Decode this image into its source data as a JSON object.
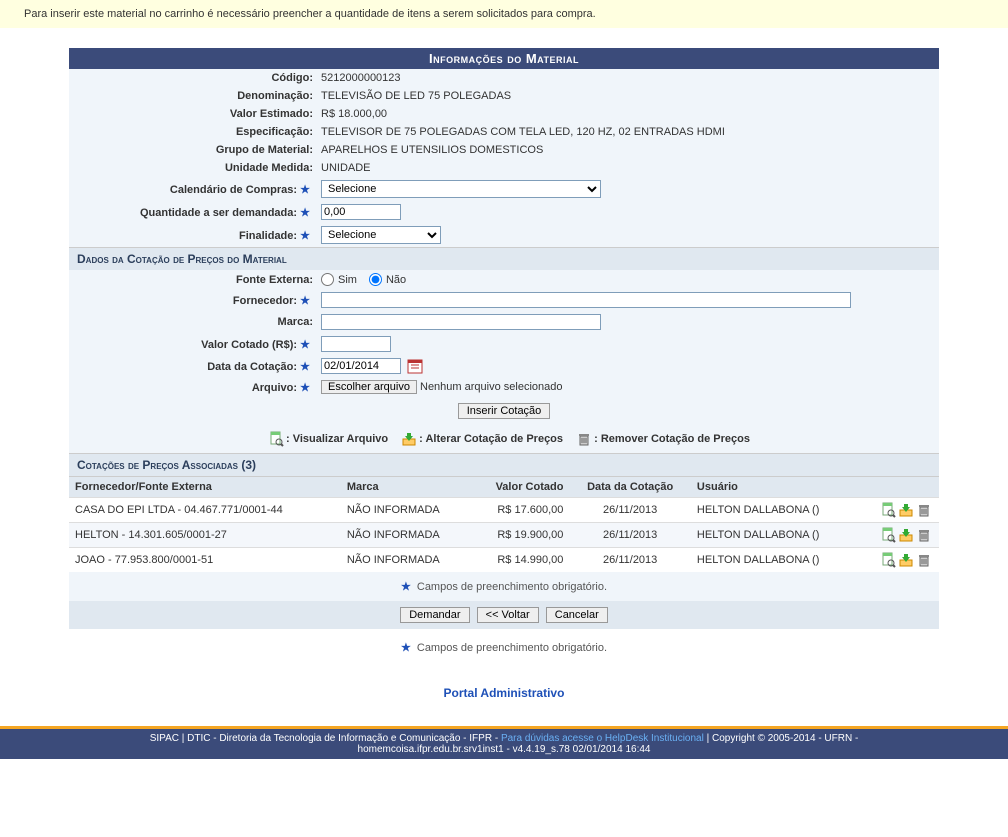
{
  "banner": "Para inserir este material no carrinho é necessário preencher a quantidade de itens a serem solicitados para compra.",
  "panel_title": "Informações do Material",
  "material": {
    "codigo_label": "Código:",
    "codigo": "5212000000123",
    "denominacao_label": "Denominação:",
    "denominacao": "TELEVISÃO DE LED 75 POLEGADAS",
    "valor_estimado_label": "Valor Estimado:",
    "valor_estimado": "R$ 18.000,00",
    "especificacao_label": "Especificação:",
    "especificacao": "TELEVISOR DE 75 POLEGADAS COM TELA LED, 120 HZ, 02 ENTRADAS HDMI",
    "grupo_label": "Grupo de Material:",
    "grupo": "APARELHOS E UTENSILIOS DOMESTICOS",
    "unidade_label": "Unidade Medida:",
    "unidade": "UNIDADE"
  },
  "form": {
    "calendario_label": "Calendário de Compras:",
    "calendario_selected": "Selecione",
    "quantidade_label": "Quantidade a ser demandada:",
    "quantidade_value": "0,00",
    "finalidade_label": "Finalidade:",
    "finalidade_selected": "Selecione"
  },
  "cotacao_section": "Dados da Cotação de Preços do Material",
  "cotacao": {
    "fonte_label": "Fonte Externa:",
    "sim": "Sim",
    "nao": "Não",
    "fornecedor_label": "Fornecedor:",
    "marca_label": "Marca:",
    "valor_label": "Valor Cotado (R$):",
    "data_label": "Data da Cotação:",
    "data_value": "02/01/2014",
    "arquivo_label": "Arquivo:",
    "escolher_btn": "Escolher arquivo",
    "nenhum_arquivo": "Nenhum arquivo selecionado",
    "inserir_btn": "Inserir Cotação"
  },
  "legend": {
    "visualizar": ": Visualizar Arquivo",
    "alterar": ": Alterar Cotação de Preços",
    "remover": ": Remover Cotação de Preços"
  },
  "table_title": "Cotações de Preços Associadas (3)",
  "table": {
    "headers": {
      "fornecedor": "Fornecedor/Fonte Externa",
      "marca": "Marca",
      "valor": "Valor Cotado",
      "data": "Data da Cotação",
      "usuario": "Usuário"
    },
    "rows": [
      {
        "fornecedor": "CASA DO EPI LTDA - 04.467.771/0001-44",
        "marca": "NÃO INFORMADA",
        "valor": "R$ 17.600,00",
        "data": "26/11/2013",
        "usuario": "HELTON DALLABONA ()"
      },
      {
        "fornecedor": "HELTON - 14.301.605/0001-27",
        "marca": "NÃO INFORMADA",
        "valor": "R$ 19.900,00",
        "data": "26/11/2013",
        "usuario": "HELTON DALLABONA ()"
      },
      {
        "fornecedor": "JOAO - 77.953.800/0001-51",
        "marca": "NÃO INFORMADA",
        "valor": "R$ 14.990,00",
        "data": "26/11/2013",
        "usuario": "HELTON DALLABONA ()"
      }
    ]
  },
  "campos_obrig": "Campos de preenchimento obrigatório.",
  "buttons": {
    "demandar": "Demandar",
    "voltar": "<< Voltar",
    "cancelar": "Cancelar"
  },
  "portal_link": "Portal Administrativo",
  "footer": {
    "left": "SIPAC | DTIC - Diretoria da Tecnologia de Informação e Comunicação - IFPR - ",
    "help": "Para dúvidas acesse o HelpDesk Institucional",
    "right": " | Copyright © 2005-2014 - UFRN -",
    "line2": "homemcoisa.ifpr.edu.br.srv1inst1 - v4.4.19_s.78 02/01/2014 16:44"
  }
}
